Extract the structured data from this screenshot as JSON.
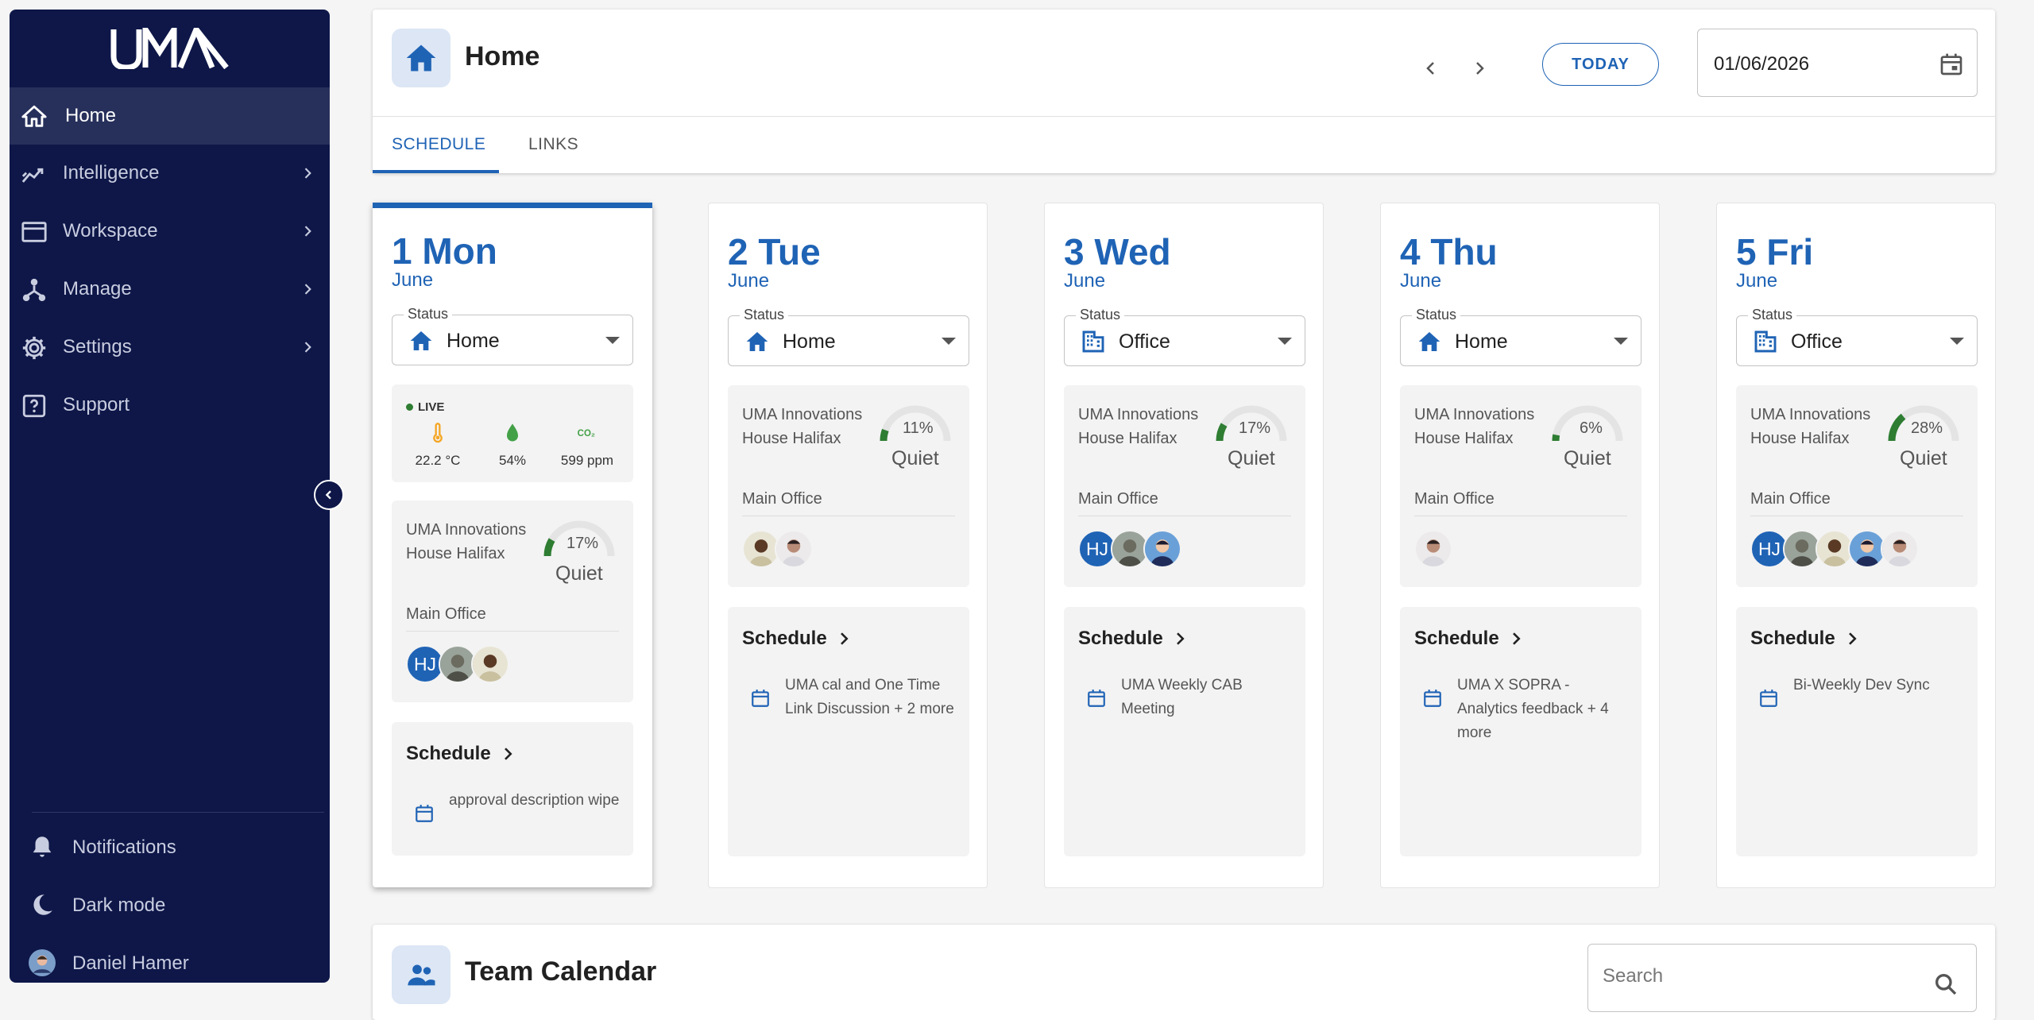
{
  "sidebar": {
    "brand": "UMA",
    "items": [
      {
        "label": "Home",
        "icon": "home-icon",
        "active": true
      },
      {
        "label": "Intelligence",
        "icon": "trending-icon"
      },
      {
        "label": "Workspace",
        "icon": "window-icon"
      },
      {
        "label": "Manage",
        "icon": "hub-icon"
      },
      {
        "label": "Settings",
        "icon": "gear-icon"
      },
      {
        "label": "Support",
        "icon": "help-icon"
      }
    ],
    "footer": {
      "notifications": "Notifications",
      "dark_mode": "Dark mode",
      "user": "Daniel Hamer"
    }
  },
  "header": {
    "title": "Home",
    "today_label": "TODAY",
    "date": "01/06/2026",
    "tabs": [
      "SCHEDULE",
      "LINKS"
    ],
    "active_tab": 0
  },
  "colors": {
    "accent": "#1f63b5",
    "sidebar": "#0e1748",
    "occupancy": "#2e7d32"
  },
  "days": [
    {
      "num": "1 Mon",
      "month": "June",
      "status_label": "Status",
      "status": "Home",
      "live": {
        "label": "LIVE",
        "temp": "22.2 °C",
        "humidity": "54%",
        "co2": "599 ppm"
      },
      "location": "UMA Innovations House Halifax",
      "sub_location": "Main Office",
      "occupancy": "17%",
      "occupancy_fraction": 0.17,
      "quiet": "Quiet",
      "schedule_label": "Schedule",
      "event": "approval description wipe"
    },
    {
      "num": "2 Tue",
      "month": "June",
      "status_label": "Status",
      "status": "Home",
      "location": "UMA Innovations House Halifax",
      "sub_location": "Main Office",
      "occupancy": "11%",
      "occupancy_fraction": 0.11,
      "quiet": "Quiet",
      "schedule_label": "Schedule",
      "event": "UMA cal and One Time Link Discussion + 2 more"
    },
    {
      "num": "3 Wed",
      "month": "June",
      "status_label": "Status",
      "status": "Office",
      "location": "UMA Innovations House Halifax",
      "sub_location": "Main Office",
      "occupancy": "17%",
      "occupancy_fraction": 0.17,
      "quiet": "Quiet",
      "schedule_label": "Schedule",
      "event": "UMA Weekly CAB Meeting"
    },
    {
      "num": "4 Thu",
      "month": "June",
      "status_label": "Status",
      "status": "Home",
      "location": "UMA Innovations House Halifax",
      "sub_location": "Main Office",
      "occupancy": "6%",
      "occupancy_fraction": 0.06,
      "quiet": "Quiet",
      "schedule_label": "Schedule",
      "event": "UMA X SOPRA - Analytics feedback + 4 more"
    },
    {
      "num": "5 Fri",
      "month": "June",
      "status_label": "Status",
      "status": "Office",
      "location": "UMA Innovations House Halifax",
      "sub_location": "Main Office",
      "occupancy": "28%",
      "occupancy_fraction": 0.28,
      "quiet": "Quiet",
      "schedule_label": "Schedule",
      "event": "Bi-Weekly Dev Sync"
    }
  ],
  "team": {
    "title": "Team Calendar",
    "search_placeholder": "Search",
    "initials": "HJ"
  }
}
